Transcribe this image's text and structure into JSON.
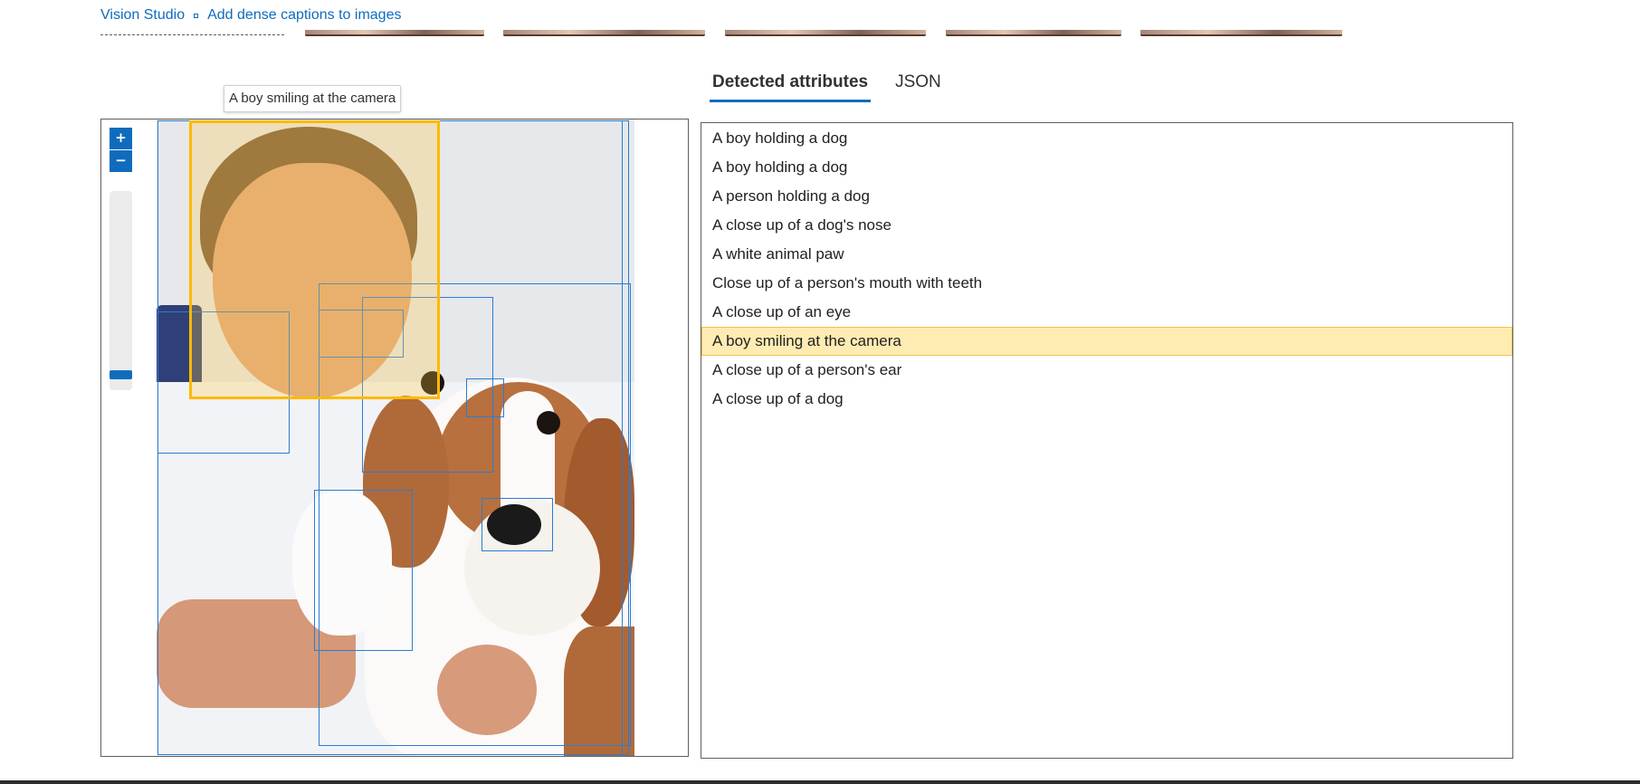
{
  "breadcrumb": {
    "items": [
      "Vision Studio",
      "Add dense captions to images"
    ]
  },
  "tooltip": {
    "text": "A boy smiling at the camera"
  },
  "viewer": {
    "zoom_in_label": "+",
    "zoom_out_label": "−",
    "zoom_level": 0.1
  },
  "tabs": [
    {
      "label": "Detected attributes",
      "active": true
    },
    {
      "label": "JSON",
      "active": false
    }
  ],
  "captions": [
    {
      "text": "A boy holding a dog"
    },
    {
      "text": "A boy holding a dog"
    },
    {
      "text": "A person holding a dog"
    },
    {
      "text": "A close up of a dog's nose"
    },
    {
      "text": "A white animal paw"
    },
    {
      "text": "Close up of a person's mouth with teeth"
    },
    {
      "text": "A close up of an eye"
    },
    {
      "text": "A boy smiling at the camera",
      "selected": true
    },
    {
      "text": "A close up of a person's ear"
    },
    {
      "text": "A close up of a dog"
    }
  ],
  "colors": {
    "accent": "#0f6cbd",
    "box": "#2b7cd3",
    "selected_box": "#ffb900",
    "selected_row": "#ffecb3"
  }
}
